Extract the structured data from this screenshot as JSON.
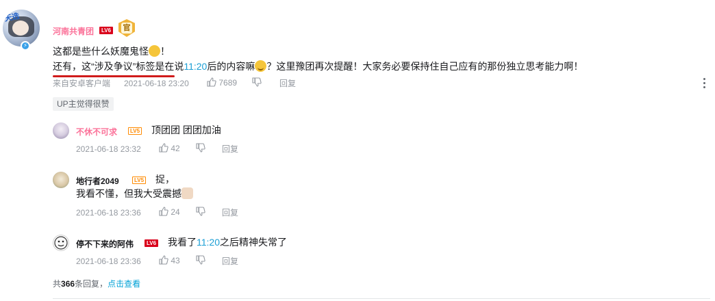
{
  "comment": {
    "user": {
      "name": "河南共青团",
      "level": "LV6"
    },
    "line1": "这都是些什么妖魔鬼怪",
    "line1_end": "！",
    "line2_a": "还有，这“涉及争议”标签是在说",
    "line2_time": "11:20",
    "line2_b": "后的内容嘛",
    "line2_c": "？这里豫团再次提醒！大家务必要保持住自己应有的那份独立思考能力啊！",
    "source": "来自安卓客户端",
    "time": "2021-06-18 23:20",
    "likes": "7689",
    "reply_label": "回复",
    "up_tag": "UP主觉得很赞",
    "highlight_color": "#1a9ed4",
    "username_color": "#fb7299"
  },
  "replies": [
    {
      "name": "不休不可求",
      "level": "LV5",
      "text": "顶团团  团团加油",
      "time": "2021-06-18 23:32",
      "likes": "42",
      "reply_label": "回复"
    },
    {
      "name": "地行者2049",
      "level": "LV5",
      "text_line1": "捉，",
      "text_line2": "我看不懂，但我大受震撼",
      "time": "2021-06-18 23:36",
      "likes": "24",
      "reply_label": "回复"
    },
    {
      "name": "停不下来的阿伟",
      "level": "LV6",
      "text_a": "我看了",
      "text_time": "11:20",
      "text_b": "之后精神失常了",
      "time": "2021-06-18 23:36",
      "likes": "43",
      "reply_label": "回复"
    }
  ],
  "more": {
    "prefix": "共",
    "count": "366",
    "suffix": "条回复，",
    "link": "点击查看"
  }
}
